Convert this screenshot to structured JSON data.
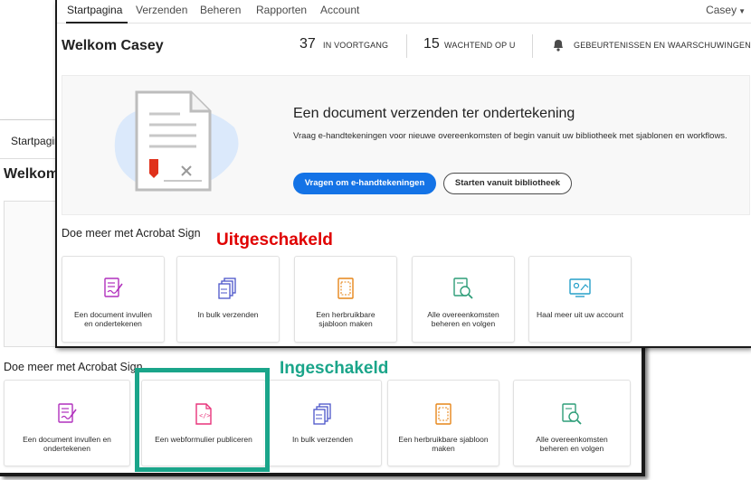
{
  "annotations": {
    "disabled": "Uitgeschakeld",
    "enabled": "Ingeschakeld"
  },
  "colors": {
    "disabled": "#e00000",
    "enabled": "#1aa58a",
    "primary_button": "#1473e6"
  },
  "front": {
    "nav": {
      "tabs": [
        {
          "label": "Startpagina",
          "active": true
        },
        {
          "label": "Verzenden"
        },
        {
          "label": "Beheren"
        },
        {
          "label": "Rapporten"
        },
        {
          "label": "Account"
        }
      ],
      "user": "Casey"
    },
    "welcome": "Welkom Casey",
    "stats": {
      "in_progress_count": "37",
      "in_progress_label": "IN VOORTGANG",
      "waiting_count": "15",
      "waiting_label": "WACHTEND OP U",
      "events_label": "GEBEURTENISSEN EN WAARSCHUWINGEN"
    },
    "hero": {
      "title": "Een document verzenden ter ondertekening",
      "description": "Vraag e-handtekeningen voor nieuwe overeenkomsten of begin vanuit uw bibliotheek met sjablonen en workflows.",
      "primary_button": "Vragen om e-handtekeningen",
      "secondary_button": "Starten vanuit bibliotheek"
    },
    "section_title": "Doe meer met Acrobat Sign",
    "cards": [
      {
        "label": "Een document invullen en ondertekenen",
        "icon": "fill-sign-icon"
      },
      {
        "label": "In bulk verzenden",
        "icon": "bulk-send-icon"
      },
      {
        "label": "Een herbruikbare sjabloon maken",
        "icon": "template-icon"
      },
      {
        "label": "Alle overeenkomsten beheren en volgen",
        "icon": "manage-track-icon"
      },
      {
        "label": "Haal meer uit uw account",
        "icon": "account-icon"
      }
    ]
  },
  "back": {
    "nav_tab": "Startpagina",
    "welcome": "Welkom",
    "section_title": "Doe meer met Acrobat Sign",
    "cards": [
      {
        "label": "Een document invullen en ondertekenen",
        "icon": "fill-sign-icon"
      },
      {
        "label": "Een webformulier publiceren",
        "icon": "web-form-icon"
      },
      {
        "label": "In bulk verzenden",
        "icon": "bulk-send-icon"
      },
      {
        "label": "Een herbruikbare sjabloon maken",
        "icon": "template-icon"
      },
      {
        "label": "Alle overeenkomsten beheren en volgen",
        "icon": "manage-track-icon"
      }
    ]
  }
}
